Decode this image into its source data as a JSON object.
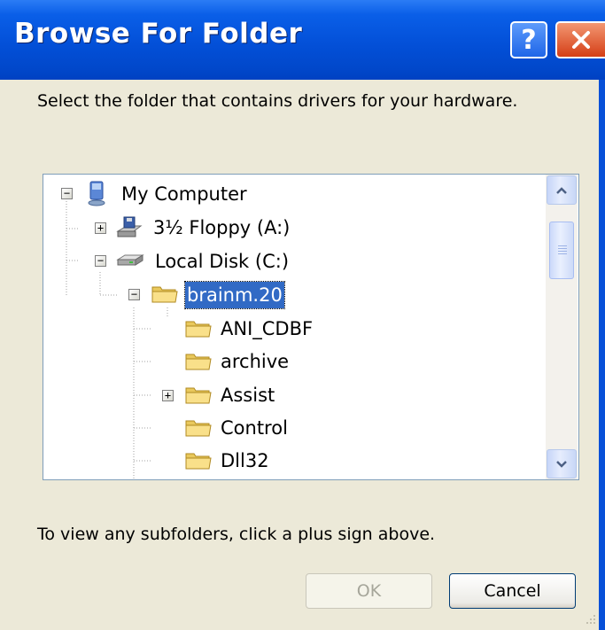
{
  "window": {
    "title": "Browse For Folder",
    "help_label": "?",
    "prompt": "Select the folder that contains drivers for your hardware.",
    "hint": "To view any subfolders, click a plus sign above."
  },
  "tree": {
    "nodes": [
      {
        "label": "My Computer",
        "icon": "my-computer-icon",
        "expander": "−"
      },
      {
        "label": "3½ Floppy (A:)",
        "icon": "floppy-drive-icon",
        "expander": "+"
      },
      {
        "label": "Local Disk (C:)",
        "icon": "hard-disk-icon",
        "expander": "−"
      },
      {
        "label": "brainm.20",
        "icon": "folder-icon",
        "expander": "−",
        "selected": true
      },
      {
        "label": "ANI_CDBF",
        "icon": "folder-icon"
      },
      {
        "label": "archive",
        "icon": "folder-icon"
      },
      {
        "label": "Assist",
        "icon": "folder-icon",
        "expander": "+"
      },
      {
        "label": "Control",
        "icon": "folder-icon"
      },
      {
        "label": "Dll32",
        "icon": "folder-icon"
      }
    ]
  },
  "buttons": {
    "ok": "OK",
    "cancel": "Cancel"
  },
  "colors": {
    "titlebar": "#0350d8",
    "selection": "#316ac5",
    "close": "#d53e16",
    "dialog_bg": "#ece9d8"
  }
}
